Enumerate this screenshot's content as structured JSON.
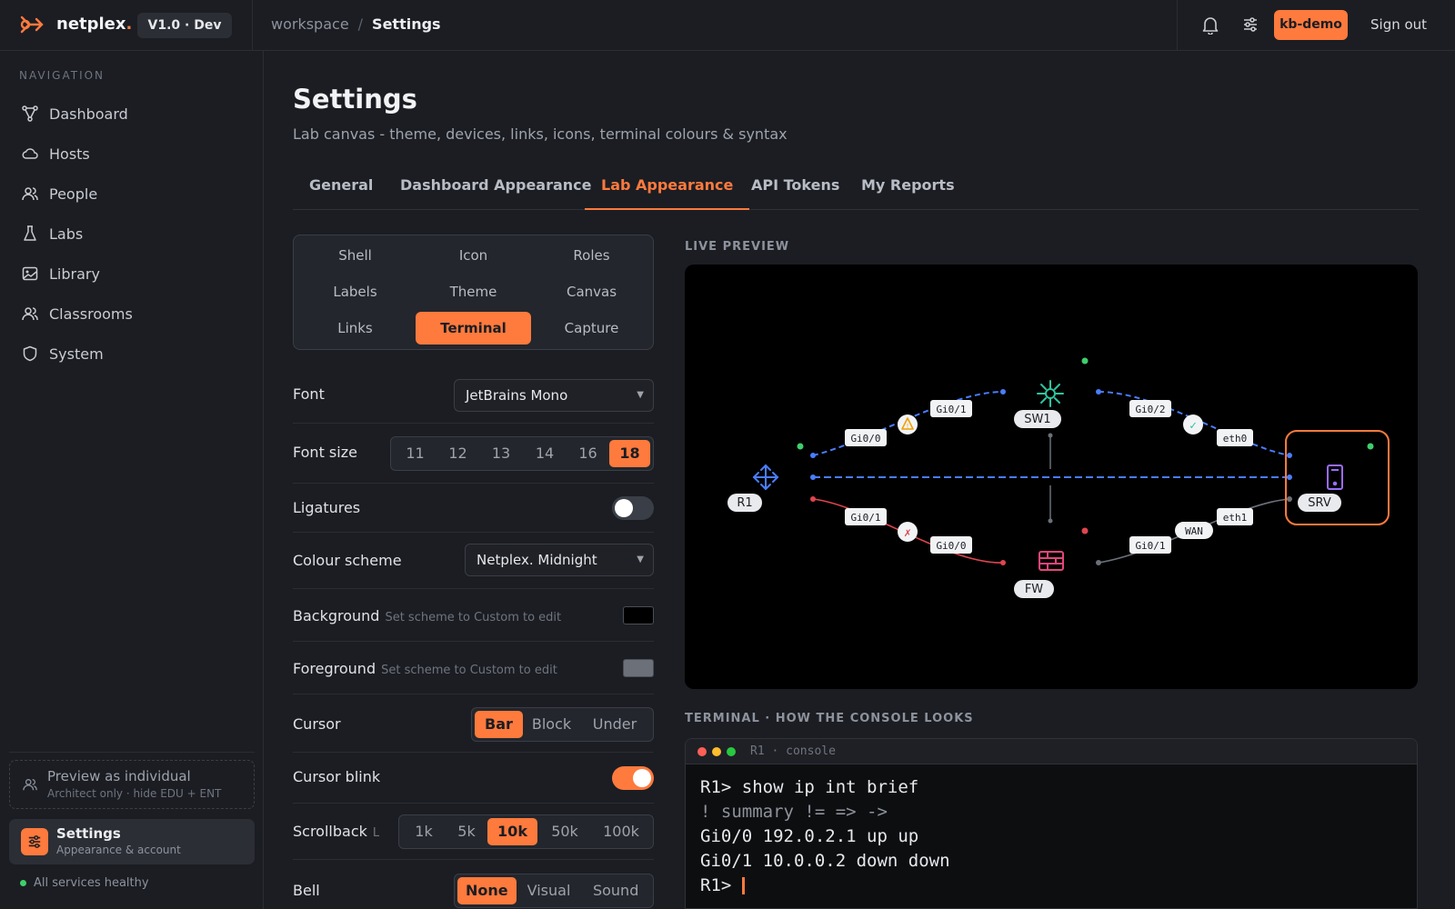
{
  "header": {
    "brand": "netplex",
    "brand_dot": ".",
    "version": "V1.0 · Dev",
    "breadcrumb_parent": "workspace",
    "breadcrumb_sep": "/",
    "breadcrumb_current": "Settings",
    "user": "kb-demo",
    "signout": "Sign out"
  },
  "sidebar": {
    "nav_label": "NAVIGATION",
    "items": [
      {
        "label": "Dashboard",
        "icon": "network-icon"
      },
      {
        "label": "Hosts",
        "icon": "cloud-icon"
      },
      {
        "label": "People",
        "icon": "people-icon"
      },
      {
        "label": "Labs",
        "icon": "flask-icon"
      },
      {
        "label": "Library",
        "icon": "image-icon"
      },
      {
        "label": "Classrooms",
        "icon": "classroom-icon"
      },
      {
        "label": "System",
        "icon": "shield-icon"
      }
    ],
    "preview_title": "Preview as individual",
    "preview_sub": "Architect only · hide EDU + ENT",
    "settings_title": "Settings",
    "settings_sub": "Appearance & account",
    "health": "All services healthy"
  },
  "page": {
    "title": "Settings",
    "subtitle": "Lab canvas - theme, devices, links, icons, terminal colours & syntax",
    "tabs": [
      "General",
      "Dashboard Appearance",
      "Lab Appearance",
      "API Tokens",
      "My Reports"
    ],
    "active_tab": "Lab Appearance"
  },
  "subtabs": [
    "Shell",
    "Icon",
    "Roles",
    "Labels",
    "Theme",
    "Canvas",
    "Links",
    "Terminal",
    "Capture"
  ],
  "active_subtab": "Terminal",
  "settings": {
    "font_label": "Font",
    "font_value": "JetBrains Mono",
    "font_size_label": "Font size",
    "font_sizes": [
      "11",
      "12",
      "13",
      "14",
      "16",
      "18"
    ],
    "font_size_selected": "18",
    "ligatures_label": "Ligatures",
    "ligatures_on": false,
    "scheme_label": "Colour scheme",
    "scheme_value": "Netplex. Midnight",
    "background_label": "Background",
    "background_hint": "Set scheme to Custom to edit",
    "background_color": "#000000",
    "foreground_label": "Foreground",
    "foreground_hint": "Set scheme to Custom to edit",
    "foreground_color": "#6b7079",
    "cursor_label": "Cursor",
    "cursor_options": [
      "Bar",
      "Block",
      "Under"
    ],
    "cursor_selected": "Bar",
    "blink_label": "Cursor blink",
    "blink_on": true,
    "scrollback_label": "Scrollback",
    "scrollback_hint": "L",
    "scrollback_options": [
      "1k",
      "5k",
      "10k",
      "50k",
      "100k"
    ],
    "scrollback_selected": "10k",
    "bell_label": "Bell",
    "bell_options": [
      "None",
      "Visual",
      "Sound"
    ],
    "bell_selected": "None"
  },
  "preview": {
    "label": "LIVE PREVIEW",
    "nodes": {
      "r1": "R1",
      "sw1": "SW1",
      "fw": "FW",
      "srv": "SRV"
    },
    "ports": {
      "r1_sw1_a": "Gi0/0",
      "r1_sw1_b": "Gi0/1",
      "sw1_srv_a": "Gi0/2",
      "sw1_srv_b": "eth0",
      "r1_fw_a": "Gi0/1",
      "r1_fw_b": "Gi0/0",
      "fw_srv_a": "Gi0/1",
      "fw_srv_wan": "WAN",
      "fw_srv_b": "eth1"
    },
    "badges": {
      "warn": "!",
      "ok": "✓",
      "err": "✗"
    },
    "colors": {
      "link_up": "#4a7dff",
      "link_down": "#e0454f",
      "link_neutral": "#8d929c",
      "accent": "#ff7a3d",
      "switch": "#2ec4a0",
      "firewall": "#e3457a",
      "server": "#9b6cff"
    }
  },
  "terminal": {
    "label": "TERMINAL · HOW THE CONSOLE LOOKS",
    "title": "R1 · console",
    "lines": [
      "R1> show ip int brief",
      "! summary != => ->",
      "Gi0/0 192.0.2.1 up up",
      "Gi0/1 10.0.0.2 down down",
      "R1> "
    ],
    "cursor_color": "#ff7a3d"
  }
}
